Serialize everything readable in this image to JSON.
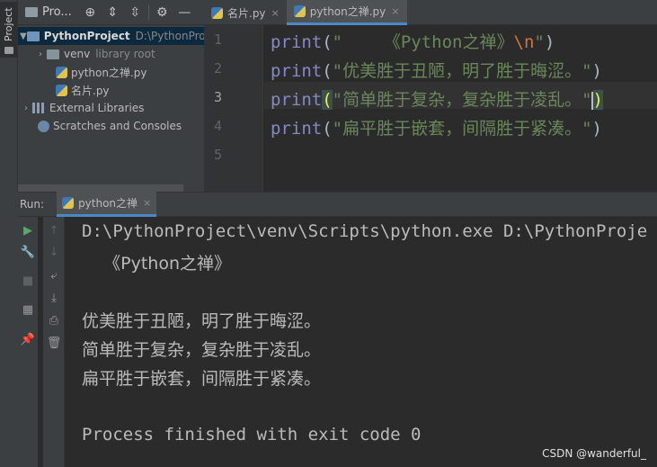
{
  "left_strip": {
    "project_tab_label": "Project"
  },
  "project_panel": {
    "title": "Pro...",
    "tree": [
      {
        "name": "PythonProject",
        "path": "D:\\PythonPro"
      },
      {
        "name": "venv",
        "note": "library root"
      },
      {
        "name": "python之禅.py"
      },
      {
        "name": "名片.py"
      },
      {
        "name": "External Libraries"
      },
      {
        "name": "Scratches and Consoles"
      }
    ]
  },
  "editor": {
    "tabs": [
      {
        "label": "名片.py",
        "close": "×"
      },
      {
        "label": "python之禅.py",
        "close": "×"
      }
    ],
    "line_numbers": [
      "1",
      "2",
      "3",
      "4",
      "5"
    ],
    "lines": [
      {
        "fn": "print",
        "open": "(",
        "str": "\"    《Python之禅》",
        "esc": "\\n",
        "str_end": "\"",
        "close": ")"
      },
      {
        "fn": "print",
        "open": "(",
        "str": "\"优美胜于丑陋，明了胜于晦涩。\"",
        "close": ")"
      },
      {
        "fn": "print",
        "open": "(",
        "str": "\"简单胜于复杂，复杂胜于凌乱。\"",
        "close": ")"
      },
      {
        "fn": "print",
        "open": "(",
        "str": "\"扁平胜于嵌套，间隔胜于紧凑。\"",
        "close": ")"
      }
    ]
  },
  "run": {
    "label": "Run:",
    "tab_label": "python之禅",
    "tab_close": "×",
    "output": [
      "D:\\PythonProject\\venv\\Scripts\\python.exe D:\\PythonProje",
      "    《Python之禅》",
      "",
      "优美胜于丑陋，明了胜于晦涩。",
      "简单胜于复杂，复杂胜于凌乱。",
      "扁平胜于嵌套，间隔胜于紧凑。",
      "",
      "Process finished with exit code 0"
    ]
  },
  "watermark": "CSDN @wanderful_",
  "colors": {
    "keyword": "#8888c6",
    "string": "#6a8759",
    "escape": "#cc7832",
    "tab_accent": "#4a88c7",
    "run_green": "#59a869"
  }
}
